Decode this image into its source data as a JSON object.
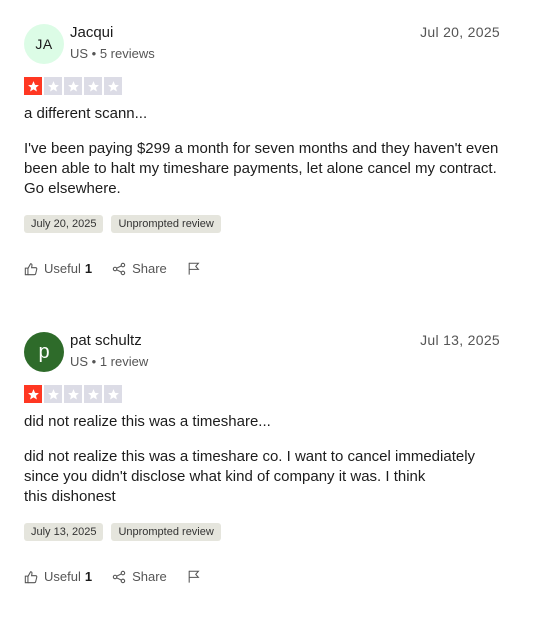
{
  "reviews": [
    {
      "avatar": "JA",
      "name": "Jacqui",
      "meta": "US • 5 reviews",
      "date": "Jul 20, 2025",
      "rating": 1,
      "title": "a different scann...",
      "body": "I've been paying $299 a month for seven months and they haven't even been able to halt my timeshare payments, let alone cancel my contract. Go elsewhere.",
      "date_tag": "July 20, 2025",
      "type_tag": "Unprompted review",
      "useful_label": "Useful",
      "useful_count": "1",
      "share_label": "Share"
    },
    {
      "avatar": "p",
      "name": "pat schultz",
      "meta": "US • 1 review",
      "date": "Jul 13, 2025",
      "rating": 1,
      "title": "did not realize this was a timeshare...",
      "body_lines": [
        "did not realize this was a timeshare co. I want to cancel immediately",
        "since you didn't disclose what kind of company it was. I think",
        "this dishonest"
      ],
      "date_tag": "July 13, 2025",
      "type_tag": "Unprompted review",
      "useful_label": "Useful",
      "useful_count": "1",
      "share_label": "Share"
    }
  ],
  "colors": {
    "star_on": "#ff3722",
    "star_off": "#dcdce6",
    "avatar_initials_bg": "#dcfce6",
    "avatar_letter_bg": "#2e6b2a"
  },
  "icons": [
    "thumbs-up-icon",
    "share-icon",
    "flag-icon",
    "star-icon"
  ]
}
